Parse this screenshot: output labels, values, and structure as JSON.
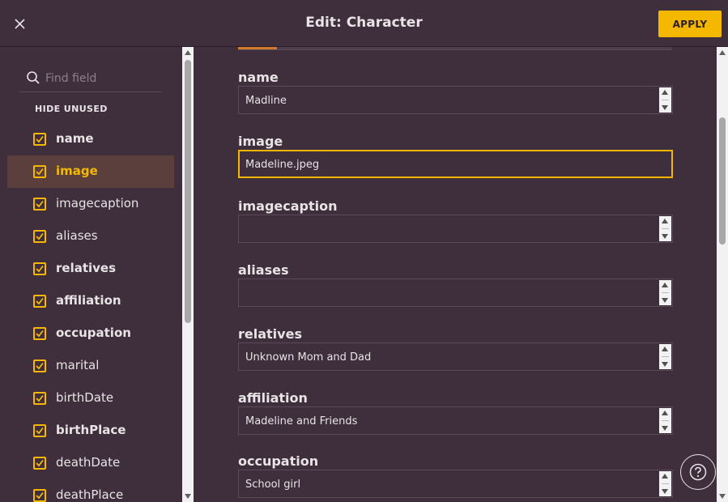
{
  "header": {
    "title": "Edit: Character",
    "apply_label": "APPLY"
  },
  "sidebar": {
    "search_placeholder": "Find field",
    "hide_unused_label": "HIDE UNUSED",
    "items": [
      {
        "label": "name",
        "checked": true,
        "bold": true,
        "active": false
      },
      {
        "label": "image",
        "checked": true,
        "bold": true,
        "active": true
      },
      {
        "label": "imagecaption",
        "checked": true,
        "bold": false,
        "active": false
      },
      {
        "label": "aliases",
        "checked": true,
        "bold": false,
        "active": false
      },
      {
        "label": "relatives",
        "checked": true,
        "bold": true,
        "active": false
      },
      {
        "label": "affiliation",
        "checked": true,
        "bold": true,
        "active": false
      },
      {
        "label": "occupation",
        "checked": true,
        "bold": true,
        "active": false
      },
      {
        "label": "marital",
        "checked": true,
        "bold": false,
        "active": false
      },
      {
        "label": "birthDate",
        "checked": true,
        "bold": false,
        "active": false
      },
      {
        "label": "birthPlace",
        "checked": true,
        "bold": true,
        "active": false
      },
      {
        "label": "deathDate",
        "checked": true,
        "bold": false,
        "active": false
      },
      {
        "label": "deathPlace",
        "checked": true,
        "bold": false,
        "active": false
      }
    ]
  },
  "form": {
    "fields": [
      {
        "label": "name",
        "value": "Madline",
        "focused": false
      },
      {
        "label": "image",
        "value": "Madeline.jpeg",
        "focused": true
      },
      {
        "label": "imagecaption",
        "value": "",
        "focused": false
      },
      {
        "label": "aliases",
        "value": "",
        "focused": false
      },
      {
        "label": "relatives",
        "value": "Unknown Mom and Dad",
        "focused": false
      },
      {
        "label": "affiliation",
        "value": "Madeline and Friends",
        "focused": false
      },
      {
        "label": "occupation",
        "value": "School girl",
        "focused": false
      }
    ]
  },
  "colors": {
    "background": "#3f2e3b",
    "accent": "#f5b800",
    "active_row": "#5a3f3d",
    "tab_indicator": "#d17a2a"
  },
  "icons": {
    "close": "close-icon",
    "search": "search-icon",
    "checkbox": "checkbox-checked-icon",
    "help": "help-icon"
  }
}
